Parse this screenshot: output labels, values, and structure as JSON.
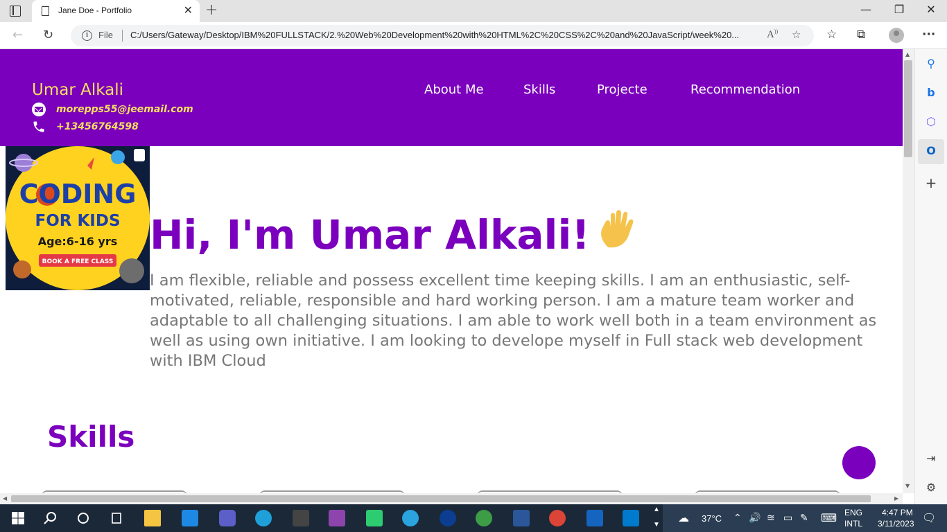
{
  "browser": {
    "tab_title": "Jane Doe - Portfolio",
    "file_label": "File",
    "url": "C:/Users/Gateway/Desktop/IBM%20FULLSTACK/2.%20Web%20Development%20with%20HTML%2C%20CSS%2C%20and%20JavaScript/week%20..."
  },
  "header": {
    "name": "Umar Alkali",
    "email": "morepps55@jeemail.com",
    "phone": "+13456764598",
    "nav": [
      "About Me",
      "Skills",
      "Projecte",
      "Recommendation"
    ]
  },
  "hero": {
    "title": "Hi, I'm Umar Alkali!",
    "about": "I am flexible, reliable and possess excellent time keeping skills. I am an enthusiastic, self-motivated, reliable, responsible and hard working person. I am a mature team worker and adaptable to all challenging situations. I am able to work well both in a team environment as well as using own initiative. I am looking to develope myself in Full stack web development with IBM Cloud",
    "image": {
      "line1": "CODING",
      "line2": "FOR KIDS",
      "age": "Age:6-16 yrs",
      "cta": "BOOK A FREE CLASS"
    }
  },
  "skills": {
    "heading": "Skills"
  },
  "taskbar": {
    "temperature": "37°C",
    "lang_top": "ENG",
    "lang_bottom": "INTL",
    "time": "4:47 PM",
    "date": "3/11/2023"
  },
  "colors": {
    "brand_purple": "#7b00bd",
    "accent_yellow": "#f6e05e",
    "body_text": "#777777"
  }
}
